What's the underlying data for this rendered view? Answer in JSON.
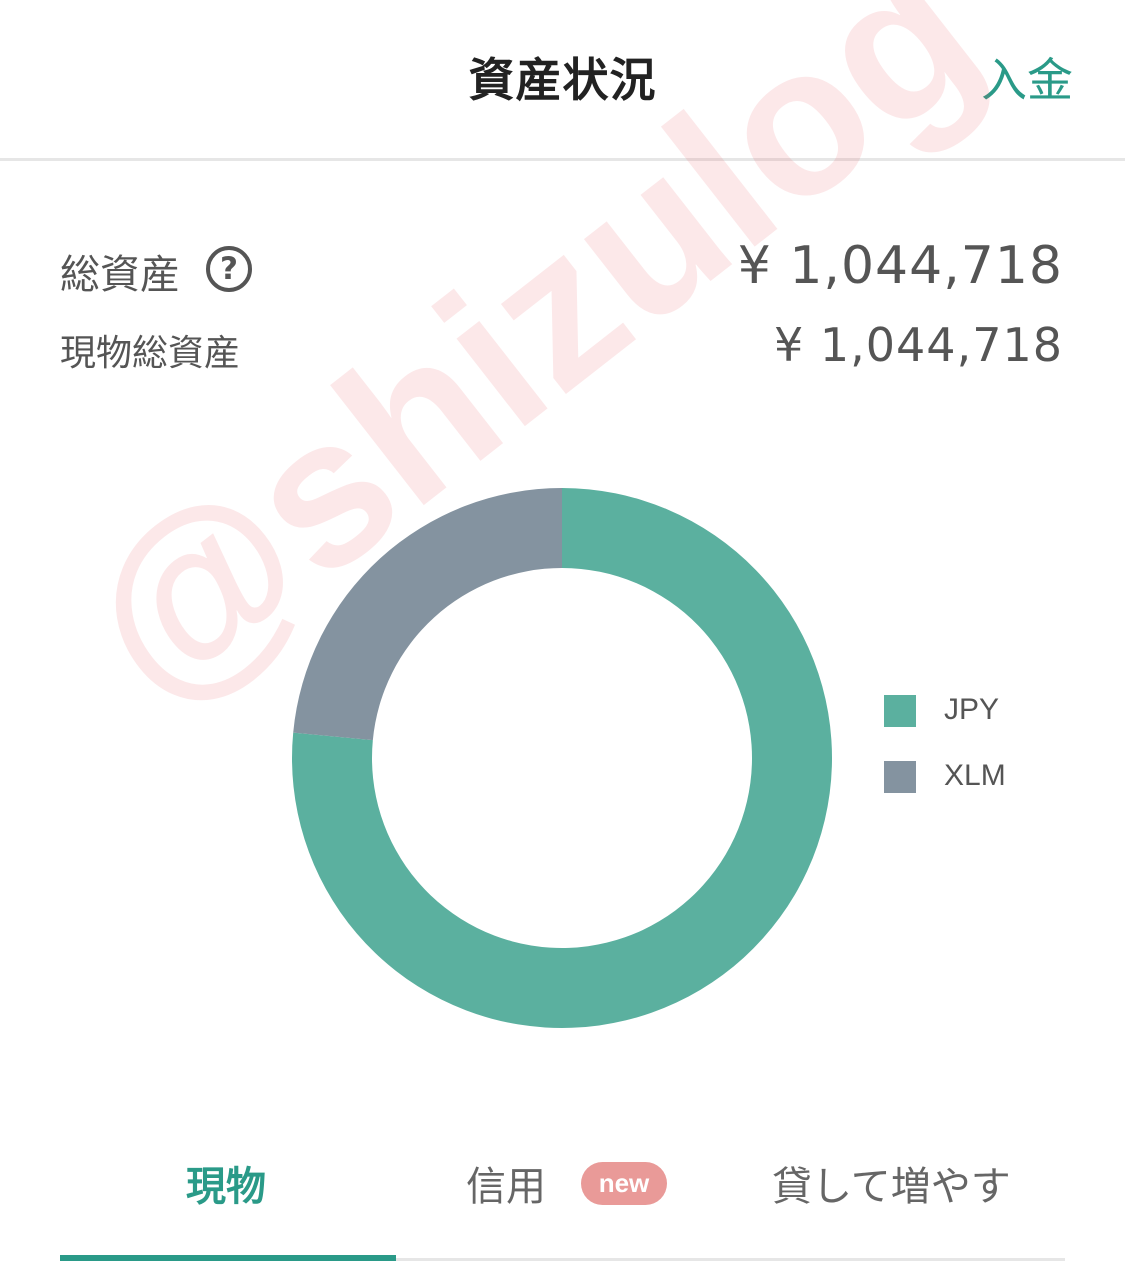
{
  "header": {
    "title": "資産状況",
    "deposit_label": "入金"
  },
  "summary": {
    "total_assets_label": "総資産",
    "total_assets_value": "¥ 1,044,718",
    "spot_assets_label": "現物総資産",
    "spot_assets_value": "¥ 1,044,718",
    "help_icon": "question-circle-icon"
  },
  "watermark": "@shizulog",
  "chart_data": {
    "type": "pie",
    "categories": [
      "JPY",
      "XLM"
    ],
    "values": [
      76.5,
      23.5
    ],
    "colors": [
      "#5bb09f",
      "#8493a0"
    ],
    "legend_position": "right",
    "donut": true
  },
  "tabs": [
    {
      "label": "現物",
      "active": true
    },
    {
      "label": "信用",
      "badge": "new"
    },
    {
      "label": "貸して増やす"
    }
  ],
  "colors": {
    "accent": "#2a9a88",
    "badge": "#e99a98"
  }
}
